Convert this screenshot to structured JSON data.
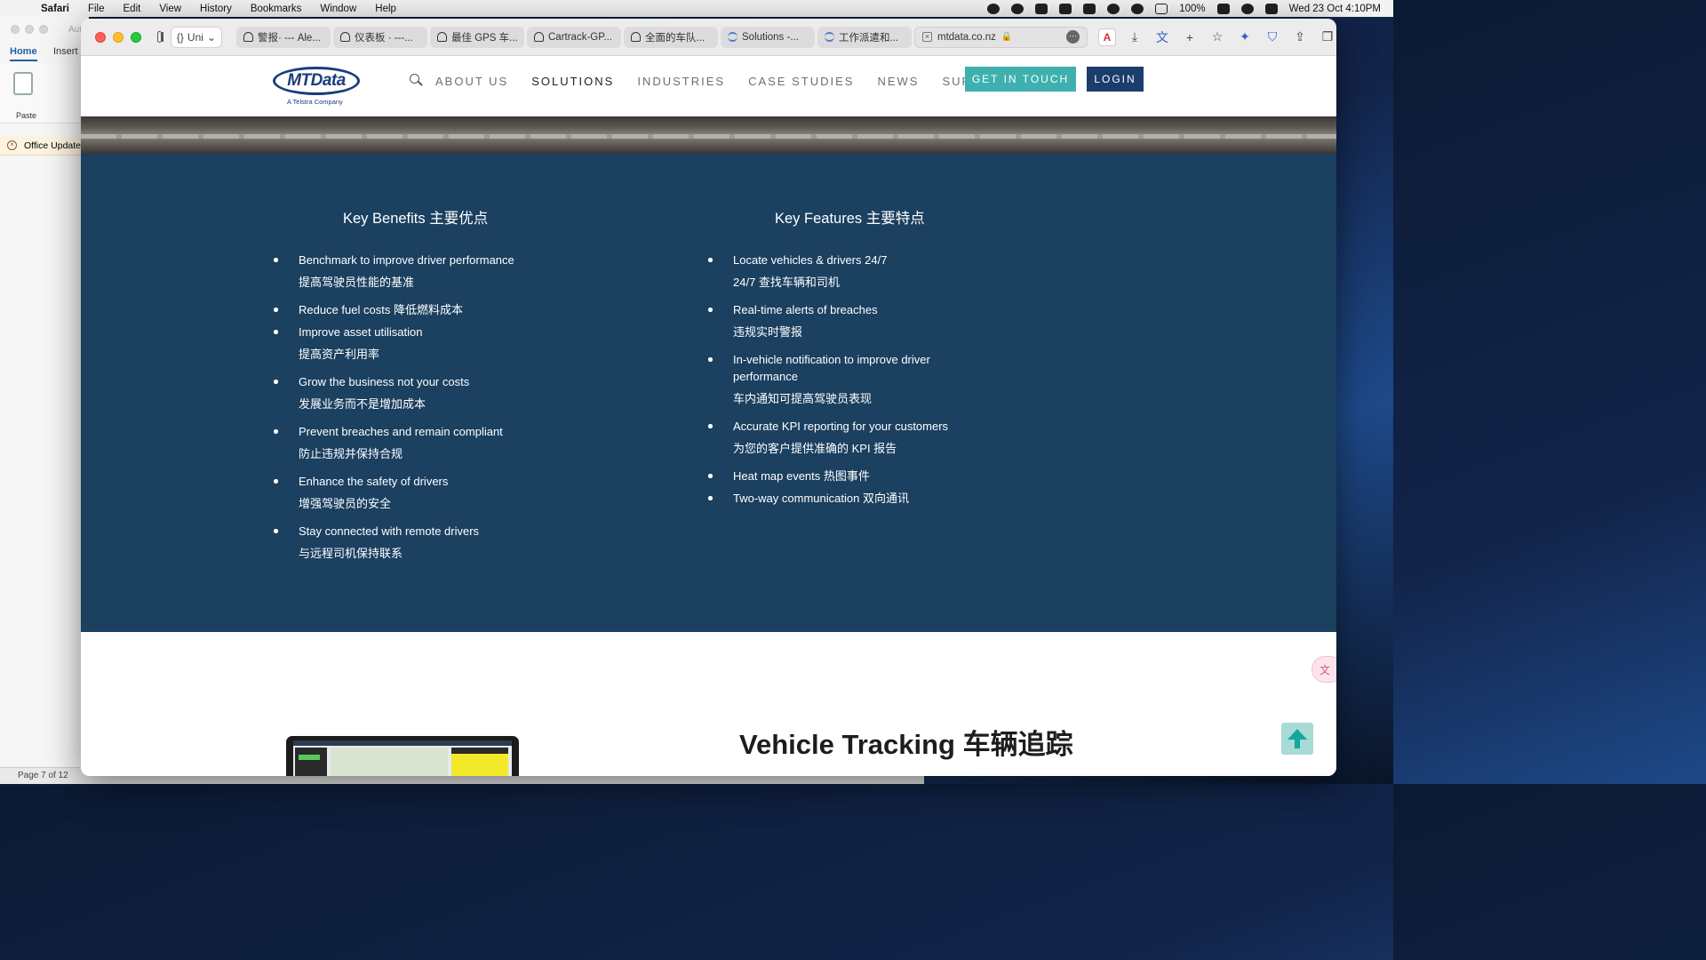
{
  "menubar": {
    "app": "Safari",
    "items": [
      "File",
      "Edit",
      "View",
      "History",
      "Bookmarks",
      "Window",
      "Help"
    ],
    "battery": "100%",
    "datetime": "Wed 23 Oct  4:10PM"
  },
  "word": {
    "autosave": "Aut",
    "tabs": [
      "Home",
      "Insert"
    ],
    "paste_label": "Paste",
    "update_bar": "Office Update",
    "page_status": "Page 7 of 12"
  },
  "safari": {
    "tab_group": "Uni",
    "tabs": [
      {
        "title": "警报· --- Ale..."
      },
      {
        "title": "仪表板 · ---..."
      },
      {
        "title": "最佳 GPS 车..."
      },
      {
        "title": "Cartrack-GP..."
      },
      {
        "title": "全面的车队..."
      },
      {
        "title": "Solutions -..."
      },
      {
        "title": "工作派遣和..."
      }
    ],
    "active_tab": {
      "title": "mtdata.co.nz"
    }
  },
  "site": {
    "logo_text": "MTData",
    "logo_sub": "A Telstra Company",
    "nav": [
      "ABOUT US",
      "SOLUTIONS",
      "INDUSTRIES",
      "CASE STUDIES",
      "NEWS",
      "SUPPORT"
    ],
    "nav_active": "SOLUTIONS",
    "cta": "GET IN TOUCH",
    "login": "LOGIN"
  },
  "benefits": {
    "title": "Key Benefits 主要优点",
    "items": [
      {
        "en": "Benchmark to improve driver performance",
        "cn": "提高驾驶员性能的基准"
      },
      {
        "en": "Reduce fuel costs  降低燃料成本",
        "cn": ""
      },
      {
        "en": "Improve asset utilisation",
        "cn": "提高资产利用率"
      },
      {
        "en": "Grow the business not your costs",
        "cn": "发展业务而不是增加成本"
      },
      {
        "en": "Prevent breaches and remain compliant",
        "cn": "防止违规并保持合规"
      },
      {
        "en": "Enhance the safety of drivers",
        "cn": "增强驾驶员的安全"
      },
      {
        "en": "Stay connected with remote drivers",
        "cn": "与远程司机保持联系"
      }
    ]
  },
  "features": {
    "title": "Key Features 主要特点",
    "items": [
      {
        "en": "Locate vehicles & drivers 24/7",
        "cn": "24/7 查找车辆和司机"
      },
      {
        "en": "Real-time alerts of breaches",
        "cn": "违规实时警报"
      },
      {
        "en": "In-vehicle notification to improve driver performance",
        "cn": "车内通知可提高驾驶员表现"
      },
      {
        "en": "Accurate KPI reporting for your customers",
        "cn": "为您的客户提供准确的 KPI 报告"
      },
      {
        "en": "Heat map events  热图事件",
        "cn": ""
      },
      {
        "en": "Two-way communication  双向通讯",
        "cn": ""
      }
    ]
  },
  "vehicle_tracking": {
    "title": "Vehicle Tracking 车辆追踪"
  }
}
